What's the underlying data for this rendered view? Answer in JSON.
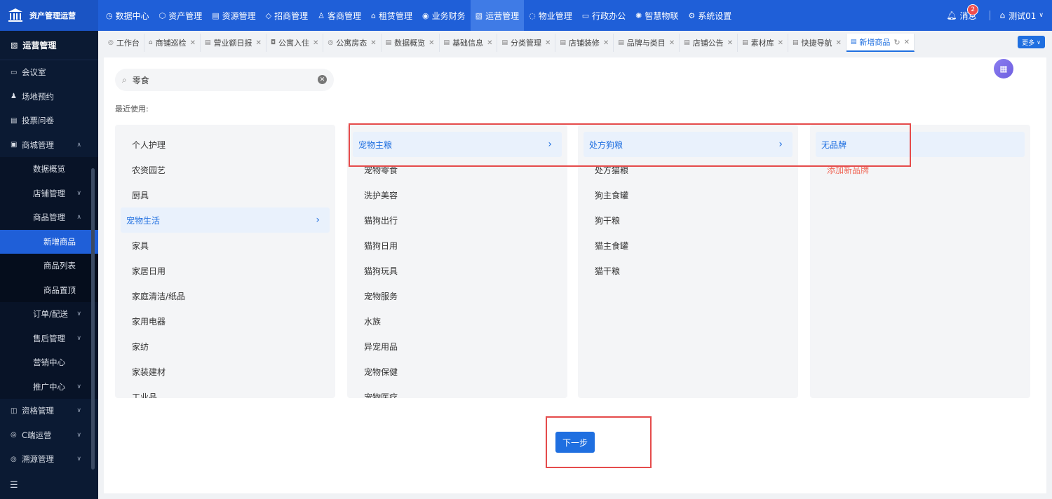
{
  "app": {
    "title": "资产管理运营"
  },
  "topnav": [
    {
      "label": "数据中心",
      "icon": "◷"
    },
    {
      "label": "资产管理",
      "icon": "⬡"
    },
    {
      "label": "资源管理",
      "icon": "▤"
    },
    {
      "label": "招商管理",
      "icon": "◇"
    },
    {
      "label": "客商管理",
      "icon": "♙"
    },
    {
      "label": "租赁管理",
      "icon": "⌂"
    },
    {
      "label": "业务财务",
      "icon": "◉"
    },
    {
      "label": "运营管理",
      "icon": "▧"
    },
    {
      "label": "物业管理",
      "icon": "◌"
    },
    {
      "label": "行政办公",
      "icon": "▭"
    },
    {
      "label": "智慧物联",
      "icon": "✺"
    },
    {
      "label": "系统设置",
      "icon": "⚙"
    }
  ],
  "header": {
    "messages_label": "消息",
    "message_count": "2",
    "user_name": "测试01"
  },
  "sidebar": {
    "section_title": "运营管理",
    "items": [
      {
        "label": "会议室",
        "icon": "▭"
      },
      {
        "label": "场地预约",
        "icon": "♟"
      },
      {
        "label": "投票问卷",
        "icon": "▤"
      },
      {
        "label": "商城管理",
        "icon": "▣"
      },
      {
        "label": "数据概览"
      },
      {
        "label": "店铺管理"
      },
      {
        "label": "商品管理"
      },
      {
        "label": "新增商品"
      },
      {
        "label": "商品列表"
      },
      {
        "label": "商品置顶"
      },
      {
        "label": "订单/配送"
      },
      {
        "label": "售后管理"
      },
      {
        "label": "营销中心"
      },
      {
        "label": "推广中心"
      },
      {
        "label": "资格管理",
        "icon": "◫"
      },
      {
        "label": "C端运营",
        "icon": "◎"
      },
      {
        "label": "溯源管理",
        "icon": "◎"
      }
    ],
    "collapse_icon": "☰"
  },
  "tabs": [
    {
      "label": "工作台",
      "icon": "◎"
    },
    {
      "label": "商铺巡检",
      "icon": "⌂"
    },
    {
      "label": "营业额日报",
      "icon": "▤"
    },
    {
      "label": "公寓入住",
      "icon": "◘"
    },
    {
      "label": "公寓房态",
      "icon": "◎"
    },
    {
      "label": "数据概览",
      "icon": "▤"
    },
    {
      "label": "基础信息",
      "icon": "▤"
    },
    {
      "label": "分类管理",
      "icon": "▤"
    },
    {
      "label": "店铺装修",
      "icon": "▤"
    },
    {
      "label": "品牌与类目",
      "icon": "▤"
    },
    {
      "label": "店铺公告",
      "icon": "▤"
    },
    {
      "label": "素材库",
      "icon": "▤"
    },
    {
      "label": "快捷导航",
      "icon": "▤"
    },
    {
      "label": "新增商品",
      "icon": "▤"
    }
  ],
  "more_label": "更多",
  "search": {
    "value": "零食"
  },
  "recent_label": "最近使用:",
  "columns": {
    "col1": [
      "个人护理",
      "农资园艺",
      "厨具",
      "宠物生活",
      "家具",
      "家居日用",
      "家庭清洁/纸品",
      "家用电器",
      "家纺",
      "家装建材",
      "工业品"
    ],
    "col2": [
      "宠物主粮",
      "宠物零食",
      "洗护美容",
      "猫狗出行",
      "猫狗日用",
      "猫狗玩具",
      "宠物服务",
      "水族",
      "异宠用品",
      "宠物保健",
      "宠物医疗"
    ],
    "col3": [
      "处方狗粮",
      "处方猫粮",
      "狗主食罐",
      "狗干粮",
      "猫主食罐",
      "猫干粮"
    ],
    "col4": [
      "无品牌",
      "添加新品牌"
    ]
  },
  "next_label": "下一步"
}
